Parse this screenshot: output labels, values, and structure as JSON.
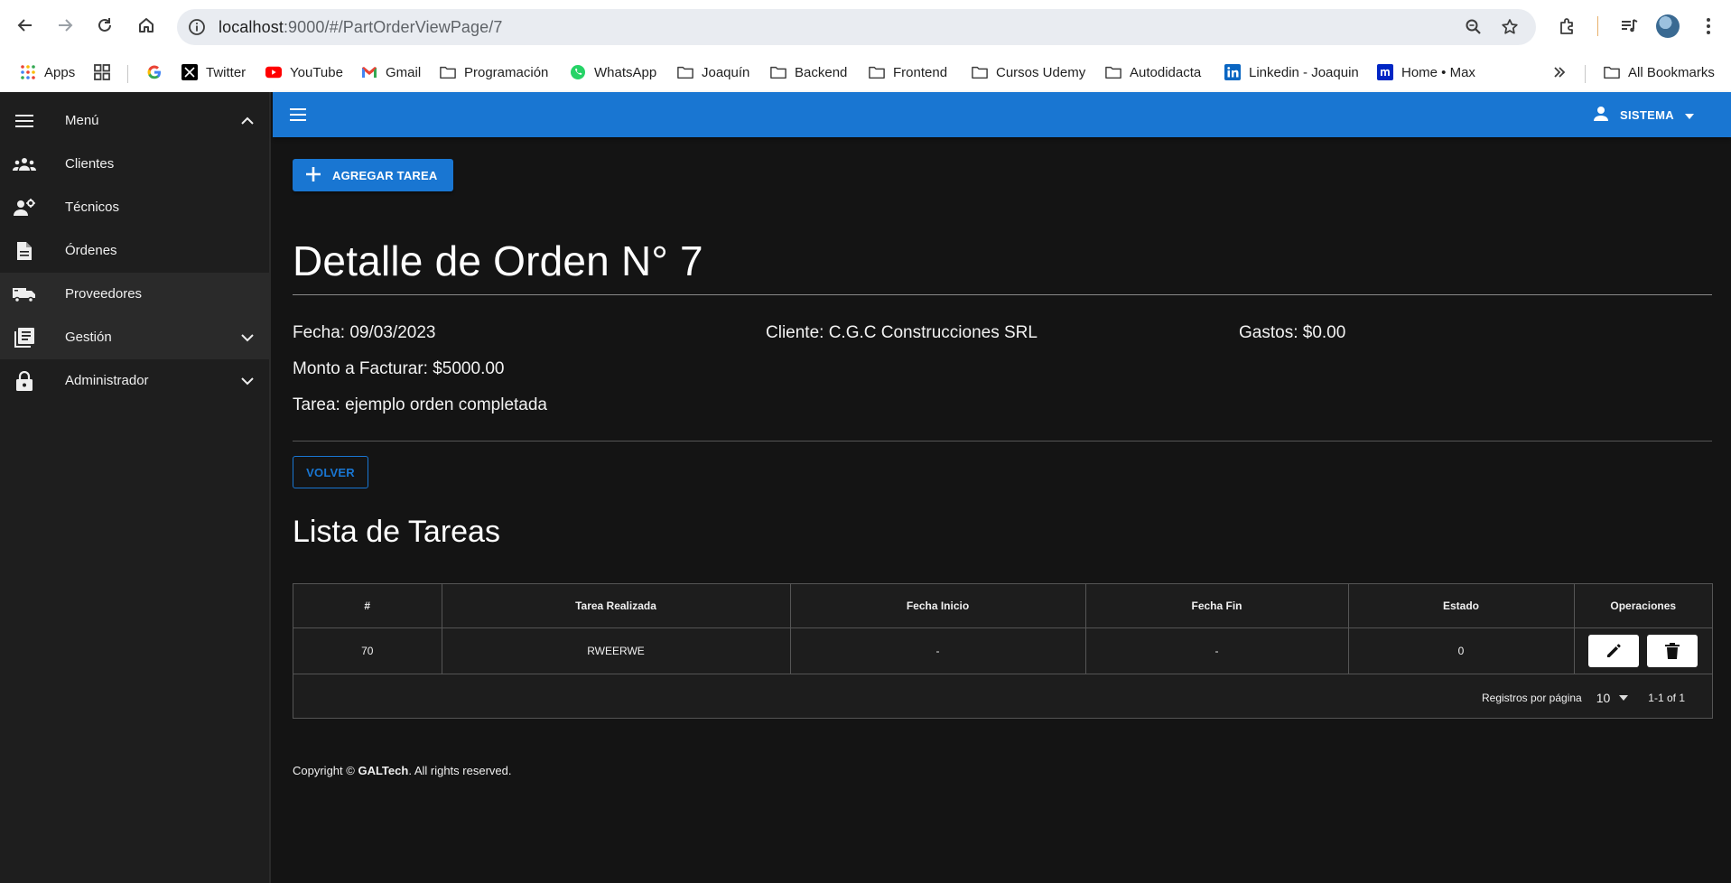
{
  "browser": {
    "url_host": "localhost",
    "url_rest": ":9000/#/PartOrderViewPage/7",
    "bookmarks": [
      {
        "label": "Apps",
        "icon": "apps-grid-icon"
      },
      {
        "label": "",
        "icon": "qr-grid-icon"
      },
      {
        "label": "",
        "icon": "google-icon"
      },
      {
        "label": "Twitter",
        "icon": "x-logo-icon"
      },
      {
        "label": "YouTube",
        "icon": "youtube-icon"
      },
      {
        "label": "Gmail",
        "icon": "gmail-icon"
      },
      {
        "label": "Programación",
        "icon": "folder-icon"
      },
      {
        "label": "WhatsApp",
        "icon": "whatsapp-icon"
      },
      {
        "label": "Joaquín",
        "icon": "folder-icon"
      },
      {
        "label": "Backend",
        "icon": "folder-icon"
      },
      {
        "label": "Frontend",
        "icon": "folder-icon"
      },
      {
        "label": "Cursos Udemy",
        "icon": "folder-icon"
      },
      {
        "label": "Autodidacta",
        "icon": "folder-icon"
      },
      {
        "label": "Linkedin - Joaquin",
        "icon": "linkedin-icon"
      },
      {
        "label": "Home • Max",
        "icon": "max-icon"
      }
    ],
    "all_bookmarks": "All Bookmarks"
  },
  "sidebar": {
    "items": [
      {
        "label": "Menú",
        "icon": "menu-icon"
      },
      {
        "label": "Clientes",
        "icon": "people-icon"
      },
      {
        "label": "Técnicos",
        "icon": "technician-icon"
      },
      {
        "label": "Órdenes",
        "icon": "document-icon"
      },
      {
        "label": "Proveedores",
        "icon": "truck-icon"
      },
      {
        "label": "Gestión",
        "icon": "library-icon"
      },
      {
        "label": "Administrador",
        "icon": "lock-icon"
      }
    ]
  },
  "appbar": {
    "user": "SISTEMA"
  },
  "actions": {
    "add_task": "AGREGAR TAREA",
    "back": "VOLVER"
  },
  "order": {
    "title": "Detalle de Orden N° 7",
    "fecha": "Fecha: 09/03/2023",
    "cliente": "Cliente: C.G.C Construcciones SRL",
    "gastos": "Gastos: $0.00",
    "monto": "Monto a Facturar: $5000.00",
    "tarea": "Tarea: ejemplo orden completada"
  },
  "tasks": {
    "title": "Lista de Tareas",
    "columns": [
      "#",
      "Tarea Realizada",
      "Fecha Inicio",
      "Fecha Fin",
      "Estado",
      "Operaciones"
    ],
    "rows": [
      {
        "id": "70",
        "tarea": "RWEERWE",
        "inicio": "-",
        "fin": "-",
        "estado": "0"
      }
    ],
    "rows_per_page_label": "Registros por página",
    "rows_per_page": "10",
    "range": "1-1 of 1"
  },
  "footer": {
    "prefix": "Copyright © ",
    "brand": "GALTech",
    "suffix": ". All rights reserved."
  },
  "colors": {
    "primary": "#1976d2",
    "background": "#141414",
    "sidebar": "#1e1e1e"
  }
}
